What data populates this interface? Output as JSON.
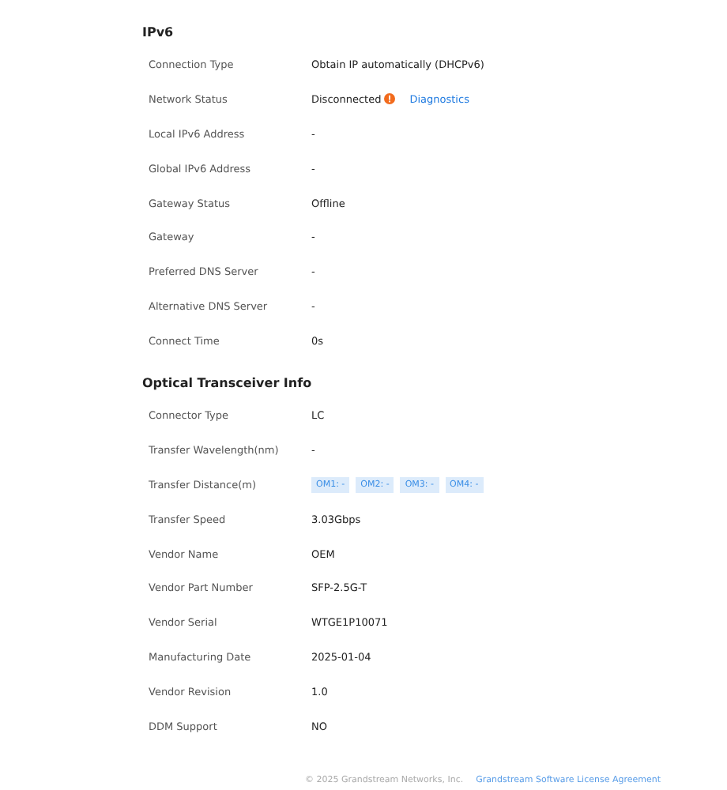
{
  "sections": [
    {
      "title": "IPv6",
      "rows": [
        {
          "kind": "text",
          "label": "Connection Type",
          "value": "Obtain IP automatically (DHCPv6)"
        },
        {
          "kind": "status",
          "label": "Network Status",
          "value": "Disconnected",
          "warning": true,
          "link": "Diagnostics"
        },
        {
          "kind": "text",
          "label": "Local IPv6 Address",
          "value": "-"
        },
        {
          "kind": "text",
          "label": "Global IPv6 Address",
          "value": "-"
        },
        {
          "kind": "text",
          "label": "Gateway Status",
          "value": "Offline"
        },
        {
          "kind": "text",
          "label": "Gateway",
          "value": "-"
        },
        {
          "kind": "text",
          "label": "Preferred DNS Server",
          "value": "-"
        },
        {
          "kind": "text",
          "label": "Alternative DNS Server",
          "value": "-"
        },
        {
          "kind": "text",
          "label": "Connect Time",
          "value": "0s"
        }
      ]
    },
    {
      "title": "Optical Transceiver Info",
      "rows": [
        {
          "kind": "text",
          "label": "Connector Type",
          "value": "LC"
        },
        {
          "kind": "text",
          "label": "Transfer Wavelength(nm)",
          "value": "-"
        },
        {
          "kind": "tags",
          "label": "Transfer Distance(m)",
          "tags": [
            "OM1: -",
            "OM2: -",
            "OM3: -",
            "OM4: -"
          ]
        },
        {
          "kind": "text",
          "label": "Transfer Speed",
          "value": "3.03Gbps"
        },
        {
          "kind": "text",
          "label": "Vendor Name",
          "value": "OEM"
        },
        {
          "kind": "text",
          "label": "Vendor Part Number",
          "value": "SFP-2.5G-T"
        },
        {
          "kind": "text",
          "label": "Vendor Serial",
          "value": "WTGE1P10071"
        },
        {
          "kind": "text",
          "label": "Manufacturing Date",
          "value": "2025-01-04"
        },
        {
          "kind": "text",
          "label": "Vendor Revision",
          "value": "1.0"
        },
        {
          "kind": "text",
          "label": "DDM Support",
          "value": "NO"
        }
      ]
    }
  ],
  "footer": {
    "copyright": "© 2025 Grandstream Networks, Inc.",
    "link": "Grandstream Software License Agreement"
  }
}
